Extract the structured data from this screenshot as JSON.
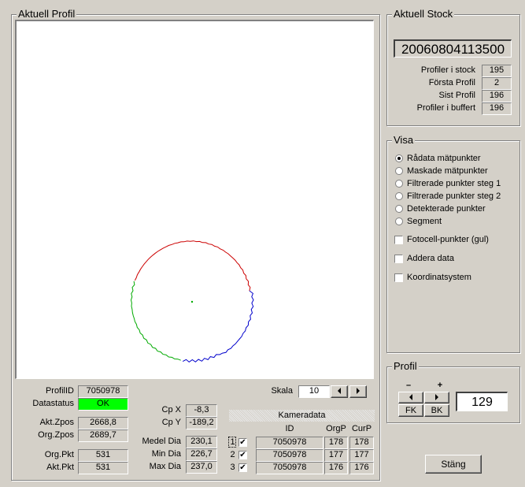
{
  "aktuell_profil": {
    "title": "Aktuell Profil",
    "plot": {
      "circle_colors": [
        "#cc0000",
        "#0000cc",
        "#00aa00"
      ],
      "center_dot_color": "#00aa00"
    },
    "info": {
      "profil_id_label": "ProfilID",
      "profil_id": "7050978",
      "datastatus_label": "Datastatus",
      "datastatus": "OK",
      "datastatus_color": "#00ff00",
      "akt_zpos_label": "Akt.Zpos",
      "akt_zpos": "2668,8",
      "org_zpos_label": "Org.Zpos",
      "org_zpos": "2689,7",
      "org_pkt_label": "Org.Pkt",
      "org_pkt": "531",
      "akt_pkt_label": "Akt.Pkt",
      "akt_pkt": "531"
    },
    "cp": {
      "cpx_label": "Cp X",
      "cpx": "-8,3",
      "cpy_label": "Cp Y",
      "cpy": "-189,2"
    },
    "dia": {
      "medel_label": "Medel Dia",
      "medel": "230,1",
      "min_label": "Min Dia",
      "min": "226,7",
      "max_label": "Max Dia",
      "max": "237,0"
    },
    "skala": {
      "label": "Skala",
      "value": "10"
    },
    "kameradata": {
      "title": "Kameradata",
      "headers": {
        "id": "ID",
        "orgp": "OrgP",
        "curp": "CurP"
      },
      "rows": [
        {
          "num": "1",
          "checked": "✔",
          "id": "7050978",
          "orgp": "178",
          "curp": "178"
        },
        {
          "num": "2",
          "checked": "✔",
          "id": "7050978",
          "orgp": "177",
          "curp": "177"
        },
        {
          "num": "3",
          "checked": "✔",
          "id": "7050978",
          "orgp": "176",
          "curp": "176"
        }
      ]
    }
  },
  "aktuell_stock": {
    "title": "Aktuell Stock",
    "stock_id": "20060804113500",
    "rows": [
      {
        "label": "Profiler i stock",
        "value": "195"
      },
      {
        "label": "Första Profil",
        "value": "2"
      },
      {
        "label": "Sist Profil",
        "value": "196"
      },
      {
        "label": "Profiler i buffert",
        "value": "196"
      }
    ]
  },
  "visa": {
    "title": "Visa",
    "radios": [
      {
        "label": "Rådata mätpunkter",
        "selected": true
      },
      {
        "label": "Maskade mätpunkter",
        "selected": false
      },
      {
        "label": "Filtrerade punkter steg 1",
        "selected": false
      },
      {
        "label": "Filtrerade punkter steg 2",
        "selected": false
      },
      {
        "label": "Detekterade punkter",
        "selected": false
      },
      {
        "label": "Segment",
        "selected": false
      }
    ],
    "checkboxes": [
      {
        "label": "Fotocell-punkter (gul)",
        "checked": false
      },
      {
        "label": "Addera data",
        "checked": false
      },
      {
        "label": "Koordinatsystem",
        "checked": false
      }
    ]
  },
  "profil": {
    "title": "Profil",
    "minus": "–",
    "plus": "+",
    "fk": "FK",
    "bk": "BK",
    "value": "129"
  },
  "stang": "Stäng"
}
